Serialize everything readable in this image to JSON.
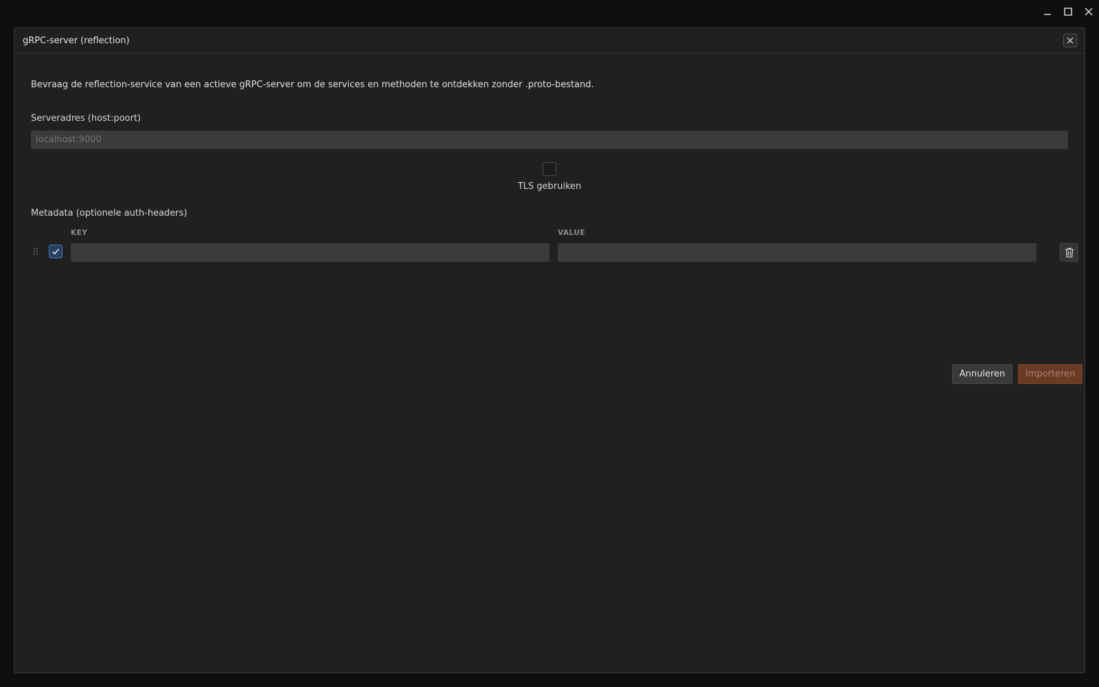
{
  "window": {
    "minimize_icon": "minimize-icon",
    "maximize_icon": "maximize-icon",
    "close_icon": "close-icon"
  },
  "dialog": {
    "title": "gRPC-server (reflection)",
    "description": "Bevraag de reflection-service van een actieve gRPC-server om de services en methoden te ontdekken zonder .proto-bestand.",
    "server": {
      "label": "Serveradres (host:poort)",
      "placeholder": "localhost:9000",
      "value": ""
    },
    "tls": {
      "label": "TLS gebruiken",
      "checked": false
    },
    "metadata": {
      "label": "Metadata (optionele auth-headers)",
      "key_header": "KEY",
      "value_header": "VALUE",
      "rows": [
        {
          "enabled": true,
          "key": "",
          "value": ""
        }
      ]
    },
    "buttons": {
      "cancel": "Annuleren",
      "import": "Importeren"
    }
  },
  "colors": {
    "background": "#0f0f0f",
    "dialog": "#202020",
    "input": "#3b3b3b",
    "accent_check": "#27405f",
    "import_button": "#6b3a24"
  }
}
